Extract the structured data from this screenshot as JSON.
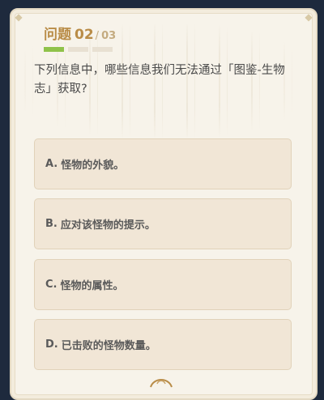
{
  "quiz": {
    "header": {
      "label": "问题",
      "current": "02",
      "separator": "/",
      "total": "03"
    },
    "progress": {
      "segments": [
        {
          "state": "done"
        },
        {
          "state": "pending"
        },
        {
          "state": "pending"
        }
      ]
    },
    "question": "下列信息中，哪些信息我们无法通过「图鉴-生物志」获取?",
    "options": [
      {
        "letter": "A.",
        "text": "怪物的外貌。"
      },
      {
        "letter": "B.",
        "text": "应对该怪物的提示。"
      },
      {
        "letter": "C.",
        "text": "怪物的属性。"
      },
      {
        "letter": "D.",
        "text": "已击败的怪物数量。"
      }
    ]
  },
  "colors": {
    "accent": "#b98c47",
    "progress_done": "#8fc24a",
    "card_bg": "#f7f3ea",
    "option_bg": "#f1e6d6",
    "page_bg": "#1e2a3d"
  }
}
